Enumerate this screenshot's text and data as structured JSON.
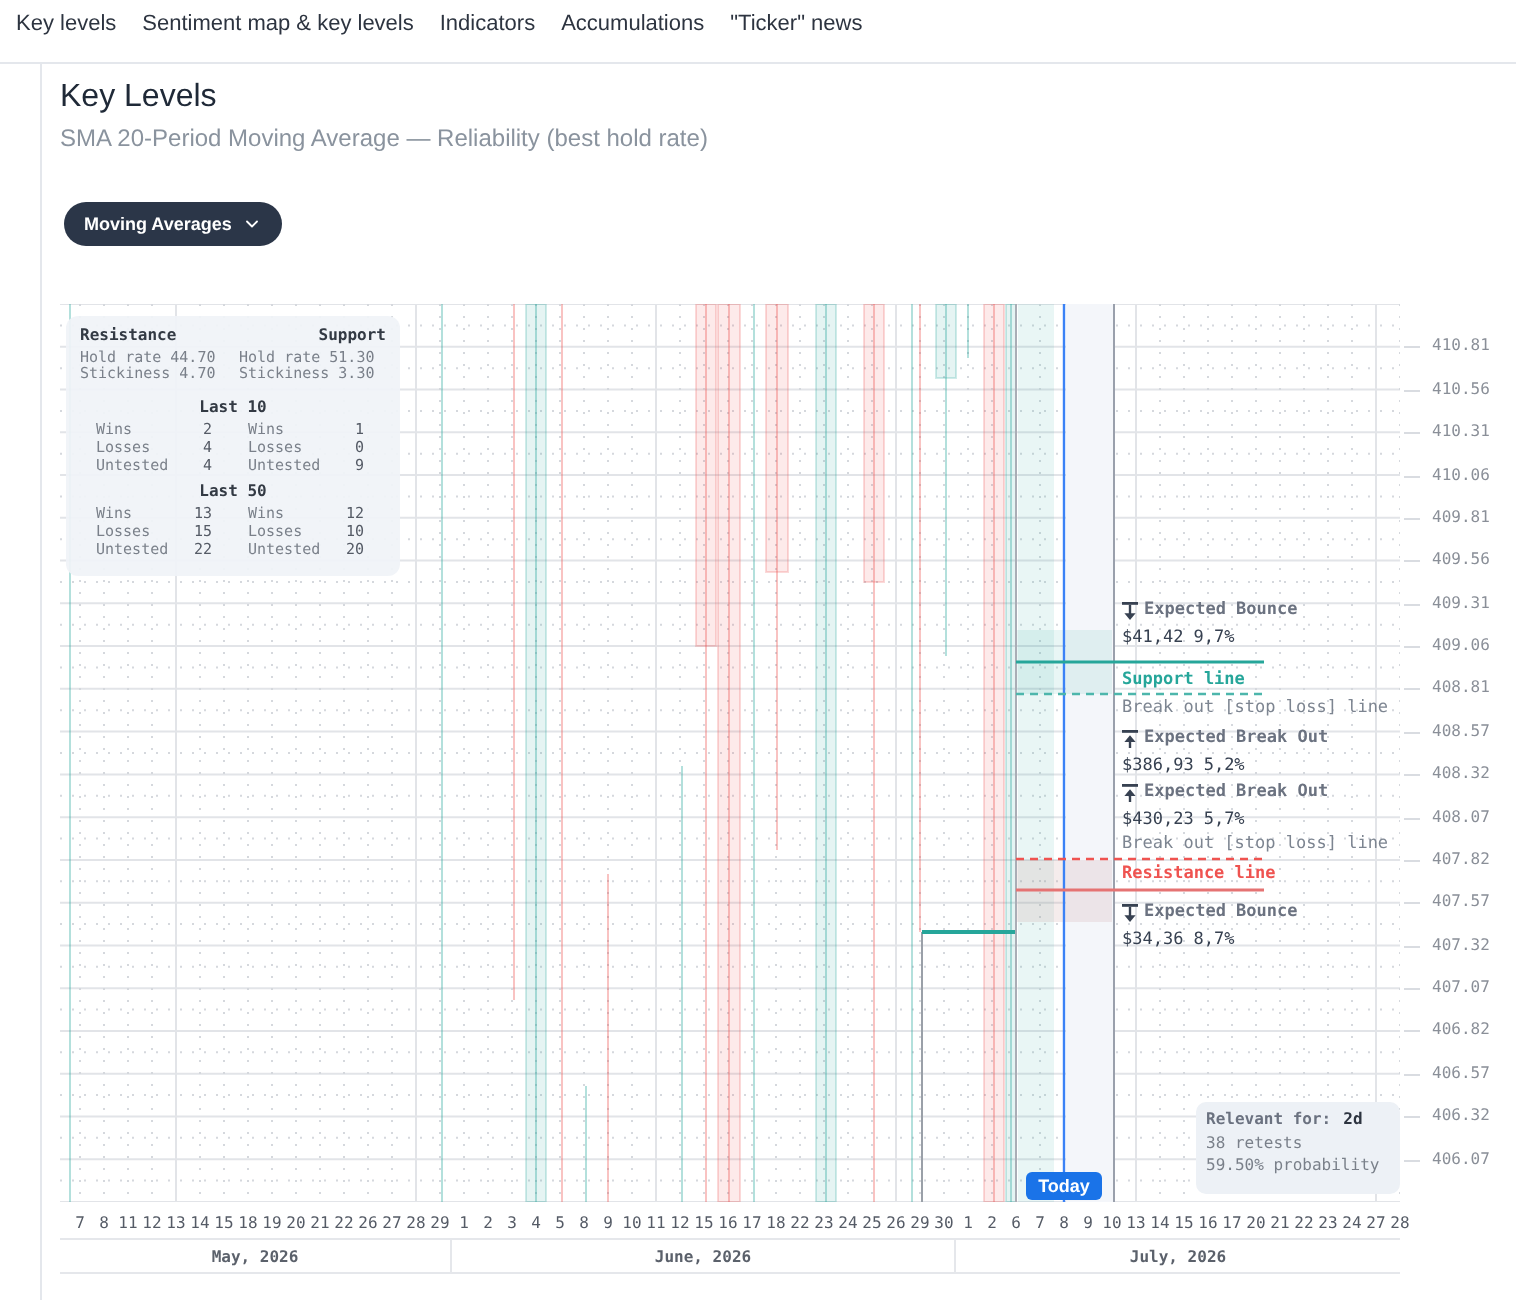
{
  "nav": {
    "tabs": [
      "Key levels",
      "Sentiment map & key levels",
      "Indicators",
      "Accumulations",
      "\"Ticker\" news"
    ]
  },
  "header": {
    "title": "Key Levels",
    "subtitle": "SMA 20-Period Moving Average — Reliability (best hold rate)"
  },
  "filter": {
    "label": "Moving Averages"
  },
  "chart": {
    "stats": {
      "resistance_title": "Resistance",
      "support_title": "Support",
      "summary": [
        {
          "resistance": "Hold rate 44.70",
          "support": "Hold rate 51.30"
        },
        {
          "resistance": "Stickiness 4.70",
          "support": "Stickiness 3.30"
        }
      ],
      "groups": [
        {
          "title": "Last 10",
          "rows": [
            {
              "resistance_label": "Wins",
              "resistance_value": "2",
              "support_label": "Wins",
              "support_value": "1"
            },
            {
              "resistance_label": "Losses",
              "resistance_value": "4",
              "support_label": "Losses",
              "support_value": "0"
            },
            {
              "resistance_label": "Untested",
              "resistance_value": "4",
              "support_label": "Untested",
              "support_value": "9"
            }
          ]
        },
        {
          "title": "Last 50",
          "rows": [
            {
              "resistance_label": "Wins",
              "resistance_value": "13",
              "support_label": "Wins",
              "support_value": "12"
            },
            {
              "resistance_label": "Losses",
              "resistance_value": "15",
              "support_label": "Losses",
              "support_value": "10"
            },
            {
              "resistance_label": "Untested",
              "resistance_value": "22",
              "support_label": "Untested",
              "support_value": "20"
            }
          ]
        }
      ]
    },
    "annotations": [
      {
        "kind": "bounce",
        "label": "Expected Bounce",
        "price": "$41,42",
        "probability": "9,7%"
      },
      {
        "kind": "support_line",
        "label": "Support line"
      },
      {
        "kind": "stop_loss",
        "label": "Break out [stop loss] line"
      },
      {
        "kind": "breakout",
        "label": "Expected Break Out",
        "price": "$386,93",
        "probability": "5,2%"
      },
      {
        "kind": "breakout",
        "label": "Expected Break Out",
        "price": "$430,23",
        "probability": "5,7%"
      },
      {
        "kind": "stop_loss",
        "label": "Break out [stop loss] line"
      },
      {
        "kind": "resistance_line",
        "label": "Resistance line"
      },
      {
        "kind": "bounce",
        "label": "Expected Bounce",
        "price": "$34,36",
        "probability": "8,7%"
      }
    ],
    "relevance": {
      "label": "Relevant for:",
      "value": "2d",
      "retests": "38 retests",
      "probability": "59.50% probability"
    },
    "today_label": "Today",
    "price_ticks": [
      "410.81",
      "410.56",
      "410.31",
      "410.06",
      "409.81",
      "409.56",
      "409.31",
      "409.06",
      "408.81",
      "408.57",
      "408.32",
      "408.07",
      "407.82",
      "407.57",
      "407.32",
      "407.07",
      "406.82",
      "406.57",
      "406.32",
      "406.07"
    ],
    "months": [
      {
        "label": "May, 2026",
        "days": [
          "7",
          "8",
          "11",
          "12",
          "13",
          "14",
          "15",
          "18",
          "19",
          "20",
          "21",
          "22",
          "26",
          "27",
          "28",
          "29"
        ]
      },
      {
        "label": "June, 2026",
        "days": [
          "1",
          "2",
          "3",
          "4",
          "5",
          "8",
          "9",
          "10",
          "11",
          "12",
          "15",
          "16",
          "17",
          "18",
          "22",
          "23",
          "24",
          "25",
          "26",
          "29",
          "30"
        ]
      },
      {
        "label": "July, 2026",
        "days": [
          "1",
          "2",
          "6",
          "7",
          "8",
          "9",
          "10",
          "13",
          "14",
          "15",
          "16",
          "17",
          "20",
          "21",
          "22",
          "23",
          "24",
          "27",
          "28"
        ]
      }
    ]
  }
}
